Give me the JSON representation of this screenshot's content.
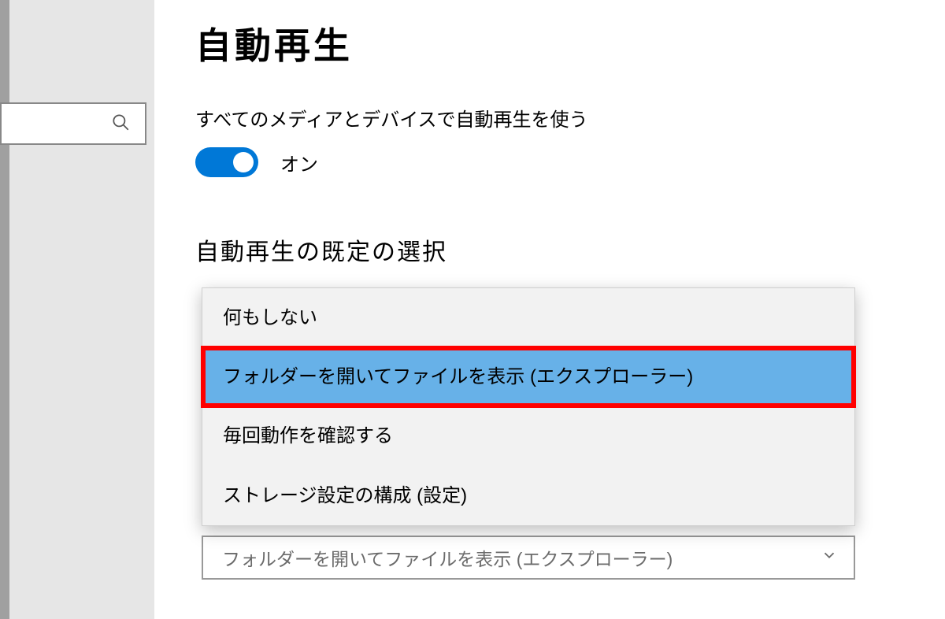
{
  "page": {
    "title": "自動再生"
  },
  "autoplay": {
    "toggle_label": "すべてのメディアとデバイスで自動再生を使う",
    "toggle_state": "オン",
    "toggle_on": true
  },
  "defaults": {
    "section_title": "自動再生の既定の選択",
    "options": [
      "何もしない",
      "フォルダーを開いてファイルを表示 (エクスプローラー)",
      "毎回動作を確認する",
      "ストレージ設定の構成 (設定)"
    ],
    "selected_index": 1,
    "select_display": "フォルダーを開いてファイルを表示 (エクスプローラー)"
  },
  "colors": {
    "accent": "#0078d7",
    "highlight_border": "#ff0000",
    "option_selected_bg": "#67b1e8"
  },
  "icons": {
    "search": "search-icon",
    "chevron_down": "chevron-down-icon"
  }
}
